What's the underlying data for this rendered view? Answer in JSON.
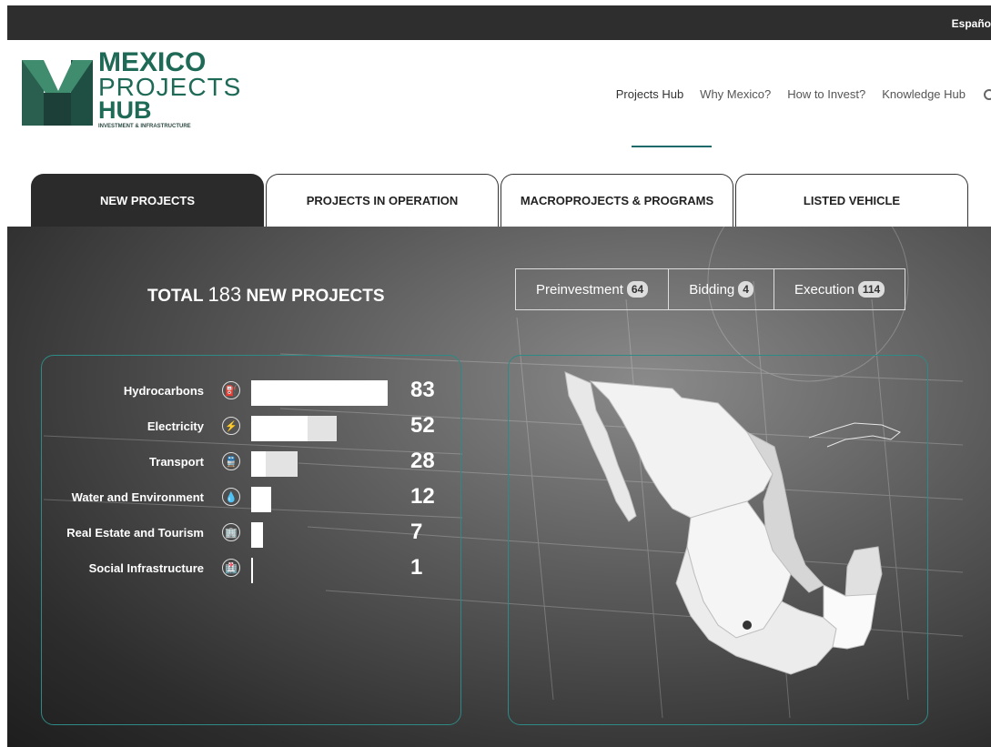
{
  "topbar": {
    "language": "Españo"
  },
  "logo": {
    "line1": "MEXICO",
    "line2": "PROJECTS",
    "line3": "HUB",
    "tagline": "INVESTMENT & INFRASTRUCTURE",
    "brand_color": "#1e6a56"
  },
  "nav": {
    "items": [
      "Projects Hub",
      "Why Mexico?",
      "How to Invest?",
      "Knowledge Hub"
    ],
    "search_icon": "search-icon",
    "active": "Projects Hub"
  },
  "tabs": [
    "NEW PROJECTS",
    "PROJECTS IN OPERATION",
    "MACROPROJECTS & PROGRAMS",
    "LISTED VEHICLE"
  ],
  "summary": {
    "prefix": "TOTAL",
    "total": "183",
    "suffix": "NEW PROJECTS"
  },
  "stages": [
    {
      "label": "Preinvestment",
      "count": "64"
    },
    {
      "label": "Bidding",
      "count": "4"
    },
    {
      "label": "Execution",
      "count": "114"
    }
  ],
  "sectors": [
    {
      "label": "Hydrocarbons",
      "count": "83",
      "value": 83,
      "icon": "oil-rig-icon"
    },
    {
      "label": "Electricity",
      "count": "52",
      "value": 52,
      "icon": "power-tower-icon"
    },
    {
      "label": "Transport",
      "count": "28",
      "value": 28,
      "icon": "train-icon"
    },
    {
      "label": "Water and Environment",
      "count": "12",
      "value": 12,
      "icon": "water-drop-icon"
    },
    {
      "label": "Real Estate and Tourism",
      "count": "7",
      "value": 7,
      "icon": "building-icon"
    },
    {
      "label": "Social Infrastructure",
      "count": "1",
      "value": 1,
      "icon": "hospital-icon"
    }
  ],
  "colors": {
    "accent": "#2e8a84",
    "dark_tab": "#2b2b2b"
  }
}
